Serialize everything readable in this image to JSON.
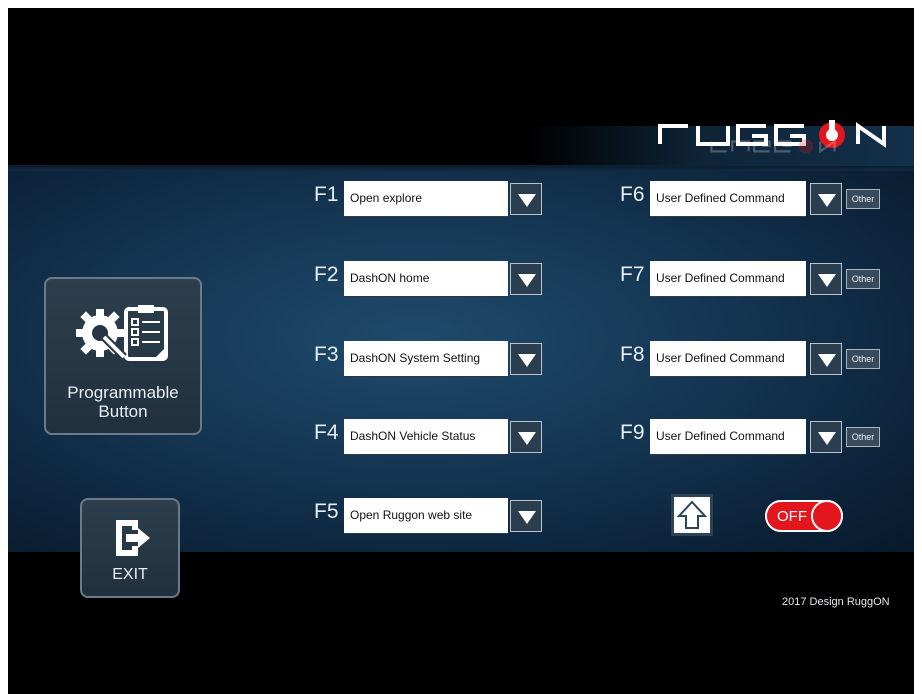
{
  "brand": {
    "logo_text": "RUGGON",
    "logo_icon": "ruggon-power-logo",
    "accent_color": "#e2161c"
  },
  "left_panel": {
    "programmable_button": {
      "label_line1": "Programmable",
      "label_line2": "Button",
      "icon": "gear-wrench-clipboard-icon"
    },
    "exit_button": {
      "label": "EXIT",
      "icon": "exit-arrow-icon"
    }
  },
  "function_keys_left": [
    {
      "key": "F1",
      "value": "Open explore"
    },
    {
      "key": "F2",
      "value": "DashON home"
    },
    {
      "key": "F3",
      "value": "DashON System Setting"
    },
    {
      "key": "F4",
      "value": "DashON Vehicle Status"
    },
    {
      "key": "F5",
      "value": "Open Ruggon web site"
    }
  ],
  "function_keys_right": [
    {
      "key": "F6",
      "value": "User Defined Command",
      "other_label": "Other"
    },
    {
      "key": "F7",
      "value": "User Defined Command",
      "other_label": "Other"
    },
    {
      "key": "F8",
      "value": "User Defined Command",
      "other_label": "Other"
    },
    {
      "key": "F9",
      "value": "User Defined Command",
      "other_label": "Other"
    }
  ],
  "controls": {
    "up_icon": "up-arrow-icon",
    "toggle_label": "OFF",
    "toggle_state": "off"
  },
  "footer": {
    "text": "2017 Design RuggON"
  },
  "colors": {
    "background": "#000000",
    "band": "#143552",
    "toggle": "#e2161c"
  }
}
